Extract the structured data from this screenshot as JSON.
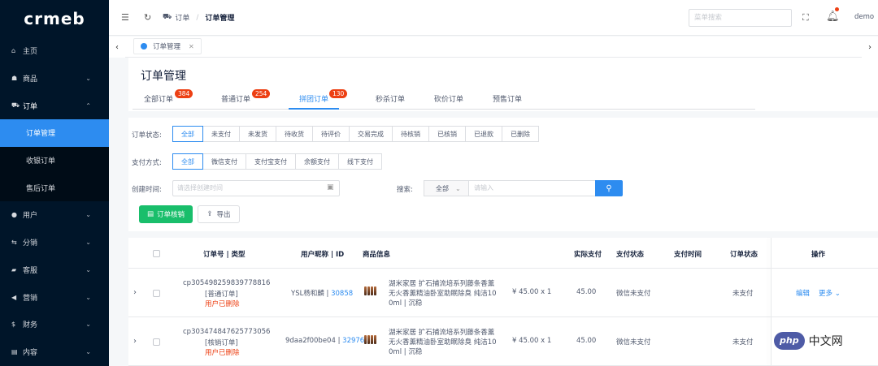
{
  "logo": {
    "text": "crmeb"
  },
  "sidebar": {
    "items": [
      {
        "icon": "home-icon",
        "glyph": "⌂",
        "label": "主页"
      },
      {
        "icon": "shop-icon",
        "glyph": "☗",
        "label": "商品"
      },
      {
        "icon": "cart-icon",
        "glyph": "⛟",
        "label": "订单"
      },
      {
        "icon": "user-icon",
        "glyph": "●",
        "label": "用户"
      },
      {
        "icon": "share-icon",
        "glyph": "⇆",
        "label": "分销"
      },
      {
        "icon": "chat-icon",
        "glyph": "▰",
        "label": "客服"
      },
      {
        "icon": "marketing-icon",
        "glyph": "◀",
        "label": "营销"
      },
      {
        "icon": "finance-icon",
        "glyph": "$",
        "label": "财务"
      },
      {
        "icon": "content-icon",
        "glyph": "▤",
        "label": "内容"
      }
    ],
    "sub_items": [
      {
        "label": "订单管理",
        "active": true
      },
      {
        "label": "收银订单",
        "active": false
      },
      {
        "label": "售后订单",
        "active": false
      }
    ]
  },
  "header": {
    "breadcrumb": [
      "订单",
      "订单管理"
    ],
    "search_placeholder": "菜单搜索",
    "user": "demo"
  },
  "tagsbar": {
    "tag_label": "订单管理"
  },
  "page": {
    "title": "订单管理",
    "tabs": [
      {
        "label": "全部订单",
        "badge": "384"
      },
      {
        "label": "普通订单",
        "badge": "254"
      },
      {
        "label": "拼团订单",
        "badge": "130"
      },
      {
        "label": "秒杀订单",
        "badge": ""
      },
      {
        "label": "砍价订单",
        "badge": ""
      },
      {
        "label": "预售订单",
        "badge": ""
      }
    ],
    "active_tab": 2
  },
  "filter": {
    "status_label": "订单状态:",
    "status_options": [
      "全部",
      "未支付",
      "未发货",
      "待收货",
      "待评价",
      "交易完成",
      "待核销",
      "已核销",
      "已退款",
      "已删除"
    ],
    "pay_label": "支付方式:",
    "pay_options": [
      "全部",
      "微信支付",
      "支付宝支付",
      "余额支付",
      "线下支付"
    ],
    "date_label": "创建时间:",
    "date_placeholder": "请选择创建时间",
    "search_label": "搜索:",
    "search_scope": "全部",
    "search_placeholder": "请输入",
    "verify_button": "订单核销",
    "export_button": "导出"
  },
  "table": {
    "headers": [
      "订单号 | 类型",
      "用户昵称 | ID",
      "商品信息",
      "实际支付",
      "支付状态",
      "支付时间",
      "订单状态",
      "操作"
    ],
    "rows": [
      {
        "order_no": "cp305498259839778816",
        "type": "[普通订单]",
        "deleted": "用户已删除",
        "user_name": "YSL杨和麟",
        "user_id": "30858",
        "goods_line1": "湖米家居 扩石捕流培系列藤条香薰",
        "goods_line2": "无火香薰精油卧室助眠除臭 纯洁10",
        "goods_line3": "0ml | 沉稳",
        "price": "¥ 45.00 x 1",
        "paid": "45.00",
        "pay_status": "微信未支付",
        "pay_time": "",
        "order_status": "未支付",
        "action_edit": "编辑",
        "action_more": "更多"
      },
      {
        "order_no": "cp303474847625773056",
        "type": "[核销订单]",
        "deleted": "用户已删除",
        "user_name": "9daa2f00be04",
        "user_id": "32976",
        "goods_line1": "湖米家居 扩石捕流培系列藤条香薰",
        "goods_line2": "无火香薰精油卧室助眠除臭 纯洁10",
        "goods_line3": "0ml | 沉稳",
        "price": "¥ 45.00 x 1",
        "paid": "45.00",
        "pay_status": "微信未支付",
        "pay_time": "",
        "order_status": "未支付"
      }
    ]
  },
  "watermark": {
    "pill": "php",
    "text": "中文网"
  },
  "colors": {
    "primary": "#2d8cf0",
    "sidebar": "#001529",
    "success": "#19be6b",
    "danger": "#ed4014"
  }
}
